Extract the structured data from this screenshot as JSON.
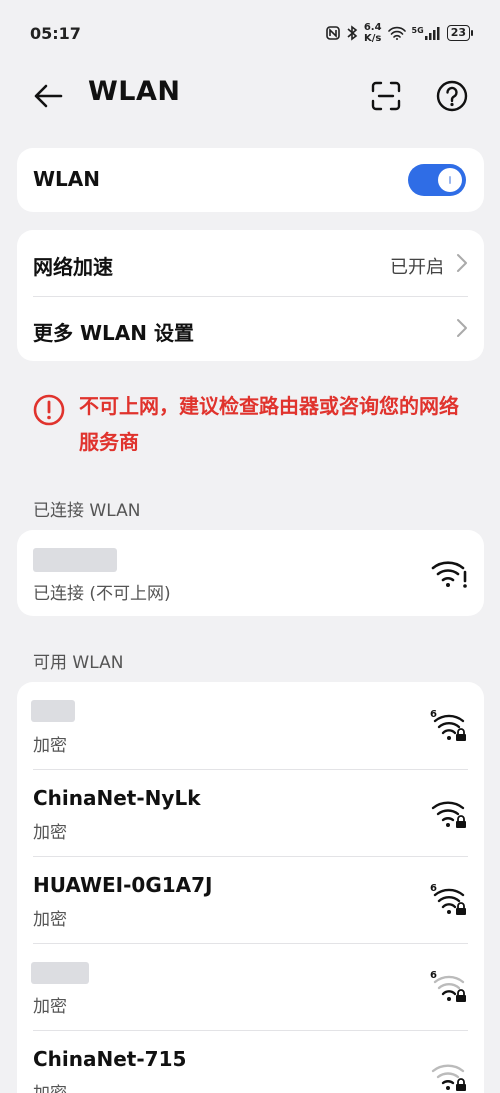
{
  "status_bar": {
    "time": "05:17",
    "net_speed_value": "6.4",
    "net_speed_unit": "K/s",
    "signal_label": "5G",
    "battery": "23"
  },
  "header": {
    "title": "WLAN"
  },
  "wlan_toggle": {
    "label": "WLAN",
    "state": "on",
    "accent_color": "#2f6de6"
  },
  "settings": {
    "accel_label": "网络加速",
    "accel_value": "已开启",
    "more_label": "更多 WLAN 设置"
  },
  "alert": {
    "message": "不可上网，建议检查路由器或咨询您的网络服务商",
    "color": "#e0332d"
  },
  "connected_section": {
    "title": "已连接 WLAN",
    "network": {
      "name": "",
      "status": "已连接 (不可上网)"
    }
  },
  "available_section": {
    "title": "可用 WLAN",
    "networks": [
      {
        "name": "",
        "security": "加密",
        "wifi6": true
      },
      {
        "name": "ChinaNet-NyLk",
        "security": "加密",
        "wifi6": false
      },
      {
        "name": "HUAWEI-0G1A7J",
        "security": "加密",
        "wifi6": true
      },
      {
        "name": "",
        "security": "加密",
        "wifi6": true
      },
      {
        "name": "ChinaNet-715",
        "security": "加密",
        "wifi6": false
      }
    ]
  }
}
